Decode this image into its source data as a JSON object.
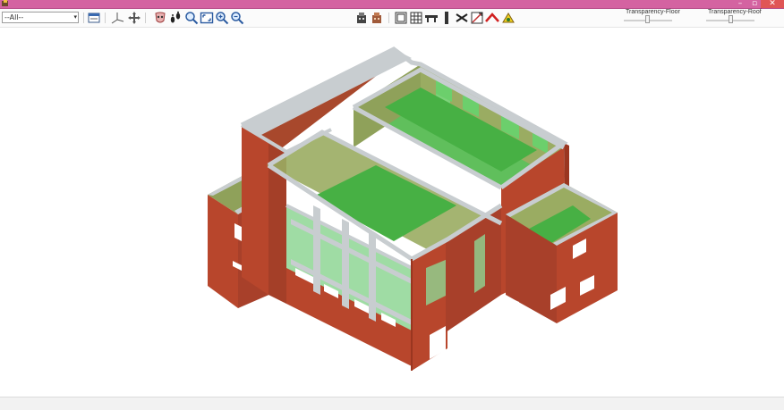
{
  "toolbar": {
    "view_select": {
      "selected": "--All--"
    },
    "icons": [
      "window-view-icon",
      "axis-icon",
      "move-icon",
      "mask-icon",
      "footprints-icon",
      "zoom-icon",
      "zoom-extents-icon",
      "zoom-in-icon",
      "zoom-out-icon",
      "building-icon",
      "building-alt-icon",
      "floor-plan-icon",
      "grid-icon",
      "beam-icon",
      "column-icon",
      "wall-cross-icon",
      "section-icon",
      "roof-icon",
      "settings-icon"
    ]
  },
  "sliders": {
    "floor": {
      "label": "Transparency-Floor",
      "value": 0.5
    },
    "roof": {
      "label": "Transparency-Roof",
      "value": 0.5
    }
  },
  "colors": {
    "titlebar": "#d463a1",
    "wall": "#b8462c",
    "wall_dark": "#9a3620",
    "floor_green": "#4fb84a",
    "olive": "#8a9a50",
    "beam": "#c8cdd0"
  }
}
